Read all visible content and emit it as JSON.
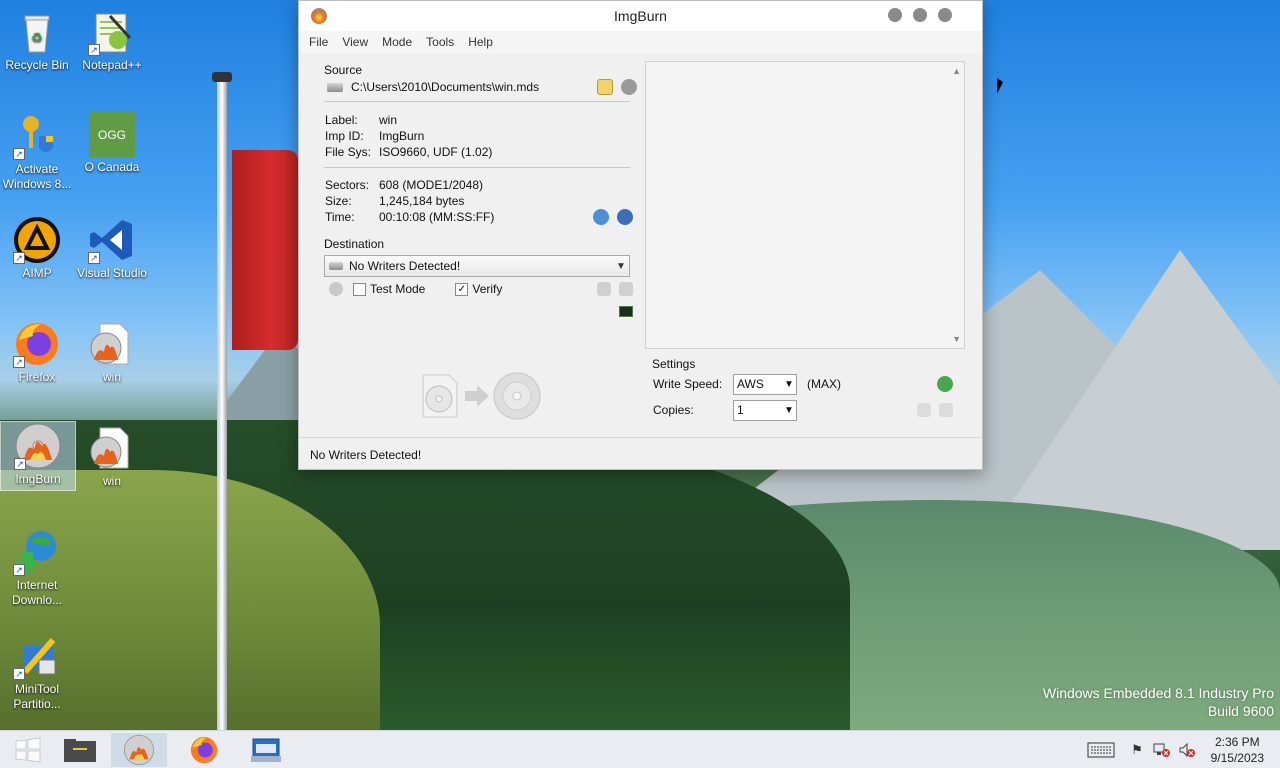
{
  "desktop": {
    "icons": [
      {
        "label": "Recycle Bin"
      },
      {
        "label": "Notepad++"
      },
      {
        "label": "Activate Windows 8..."
      },
      {
        "label": "O Canada",
        "badge": "OGG"
      },
      {
        "label": "AIMP"
      },
      {
        "label": "Visual Studio"
      },
      {
        "label": "Firefox"
      },
      {
        "label": "win"
      },
      {
        "label": "ImgBurn"
      },
      {
        "label": "win"
      },
      {
        "label": "Internet Downlo..."
      },
      {
        "label": "MiniTool Partitio..."
      }
    ],
    "watermark": {
      "line1": "Windows Embedded 8.1 Industry Pro",
      "line2": "Build 9600"
    }
  },
  "window": {
    "title": "ImgBurn",
    "menu": [
      "File",
      "View",
      "Mode",
      "Tools",
      "Help"
    ],
    "source": {
      "title": "Source",
      "path": "C:\\Users\\2010\\Documents\\win.mds",
      "label_key": "Label:",
      "label_val": "win",
      "impid_key": "Imp ID:",
      "impid_val": "ImgBurn",
      "filesys_key": "File Sys:",
      "filesys_val": "ISO9660, UDF (1.02)",
      "sectors_key": "Sectors:",
      "sectors_val": "608 (MODE1/2048)",
      "size_key": "Size:",
      "size_val": "1,245,184 bytes",
      "time_key": "Time:",
      "time_val": "00:10:08 (MM:SS:FF)"
    },
    "destination": {
      "title": "Destination",
      "selected": "No Writers Detected!",
      "test_mode_label": "Test Mode",
      "test_mode_checked": false,
      "verify_label": "Verify",
      "verify_checked": true
    },
    "settings": {
      "title": "Settings",
      "write_speed_label": "Write Speed:",
      "write_speed_value": "AWS",
      "write_speed_max": "(MAX)",
      "copies_label": "Copies:",
      "copies_value": "1"
    },
    "status": "No Writers Detected!"
  },
  "taskbar": {
    "clock_time": "2:36 PM",
    "clock_date": "9/15/2023"
  },
  "colors": {
    "accent": "#1d5fb8",
    "taskbar_bg": "#e8ecf0"
  }
}
